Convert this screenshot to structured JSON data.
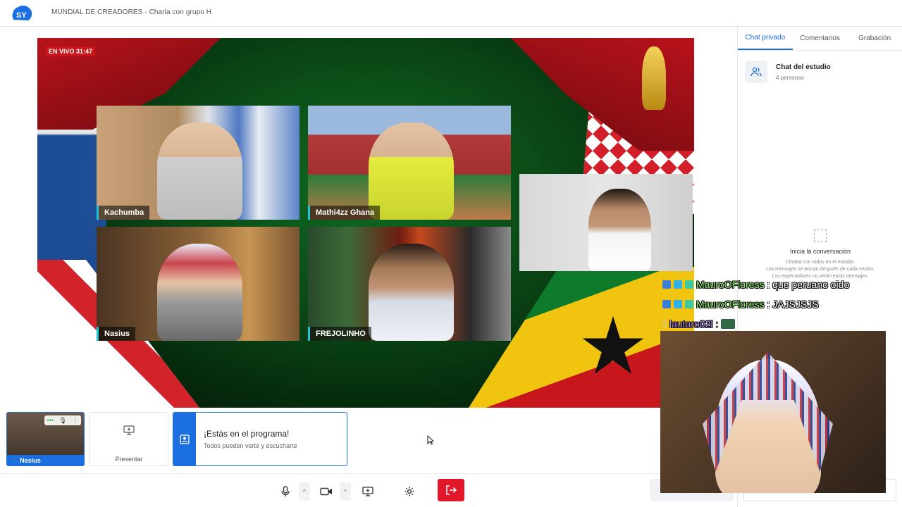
{
  "header": {
    "title": "MUNDIAL DE CREADORES - Charla con grupo H",
    "logo_icon": "streamyard-logo"
  },
  "stage": {
    "live_label": "EN VIVO 31:47",
    "participants": [
      {
        "name": "Kachumba"
      },
      {
        "name": "Mathi4zz Ghana"
      },
      {
        "name": "Nasius"
      },
      {
        "name": "FREJOLINHO"
      },
      {
        "name": ""
      }
    ]
  },
  "strip": {
    "self_name": "Nasius",
    "present_label": "Presentar",
    "onair_title": "¡Estás en el programa!",
    "onair_subtitle": "Todos pueden verte y escucharte"
  },
  "controls": {
    "icons": [
      "mic-icon",
      "camera-icon",
      "share-screen-icon",
      "settings-icon",
      "leave-icon"
    ]
  },
  "panel": {
    "tabs": [
      {
        "label": "Chat privado",
        "active": true
      },
      {
        "label": "Comentarios",
        "active": false
      },
      {
        "label": "Grabación",
        "active": false
      }
    ],
    "studio_name": "Chat del estudio",
    "studio_count": "4 personas",
    "empty_title": "Inicia la conversación",
    "empty_text1": "Chatea con todos en el estudio.",
    "empty_text2": "Los mensajes se borran después de cada sesión.",
    "empty_text3": "Los espectadores no verán estos mensajes."
  },
  "overlay_chat": [
    {
      "user": "MauroOFloress",
      "message": ": que peruano oido"
    },
    {
      "user": "MauroOFloress",
      "message": ": JAJSJSJS"
    },
    {
      "user": "lautaro02l",
      "message": ":"
    }
  ],
  "colors": {
    "accent": "#1c6fe0",
    "leave": "#e3172b",
    "live": "#c8161d"
  }
}
